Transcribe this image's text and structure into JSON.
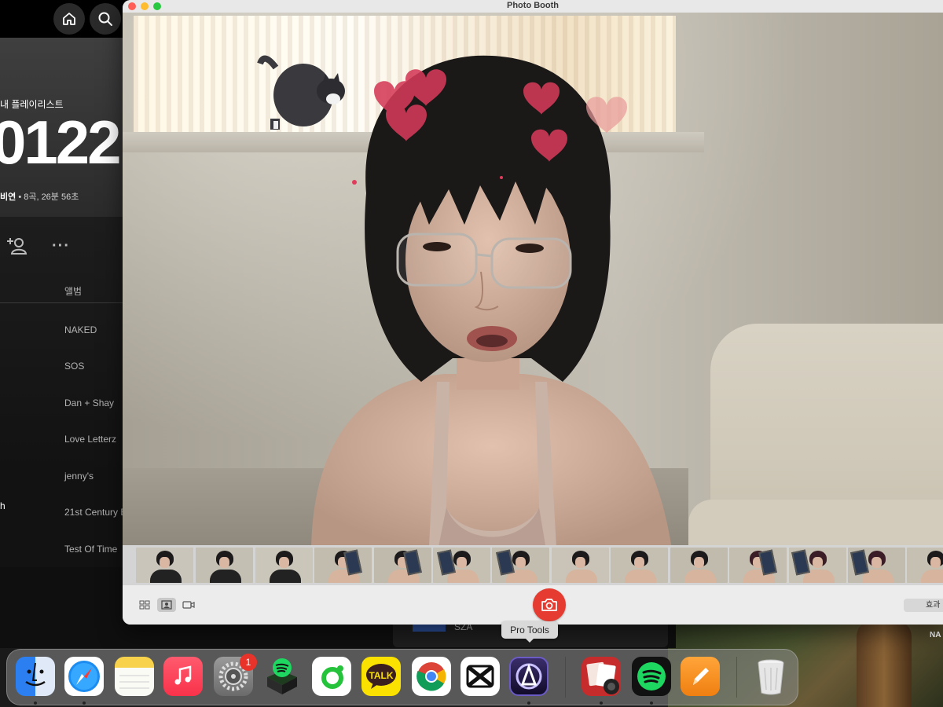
{
  "spotify": {
    "playlist_kind": "내 플레이리스트",
    "playlist_title": "0122",
    "owner_fragment": "비연",
    "meta": "• 8곡, 26분 56초",
    "more_label": "···",
    "column_album": "앨범",
    "albums": [
      "NAKED",
      "SOS",
      "Dan + Shay",
      "Love Letterz",
      "jenny's",
      "21st Century B",
      "Test Of Time"
    ],
    "row_fragment": "h",
    "card_artist": "SZA"
  },
  "photo_booth": {
    "window_title": "Photo Booth",
    "effects_label": "효과",
    "tooltip": "Pro Tools"
  },
  "dock": {
    "items": [
      "Finder",
      "Safari",
      "Notes",
      "Music",
      "System Settings",
      "Spotify Installer",
      "Naver Whale",
      "KakaoTalk",
      "Google Chrome",
      "CapCut",
      "Pro Tools",
      "Photo Booth",
      "Spotify",
      "Pages",
      "Trash"
    ],
    "settings_badge": "1",
    "talk_label": "TALK"
  },
  "wallpaper": {
    "label": "NA"
  },
  "colors": {
    "shutter": "#e63b30",
    "spotify_green": "#1ed760",
    "badge": "#e8332b"
  }
}
